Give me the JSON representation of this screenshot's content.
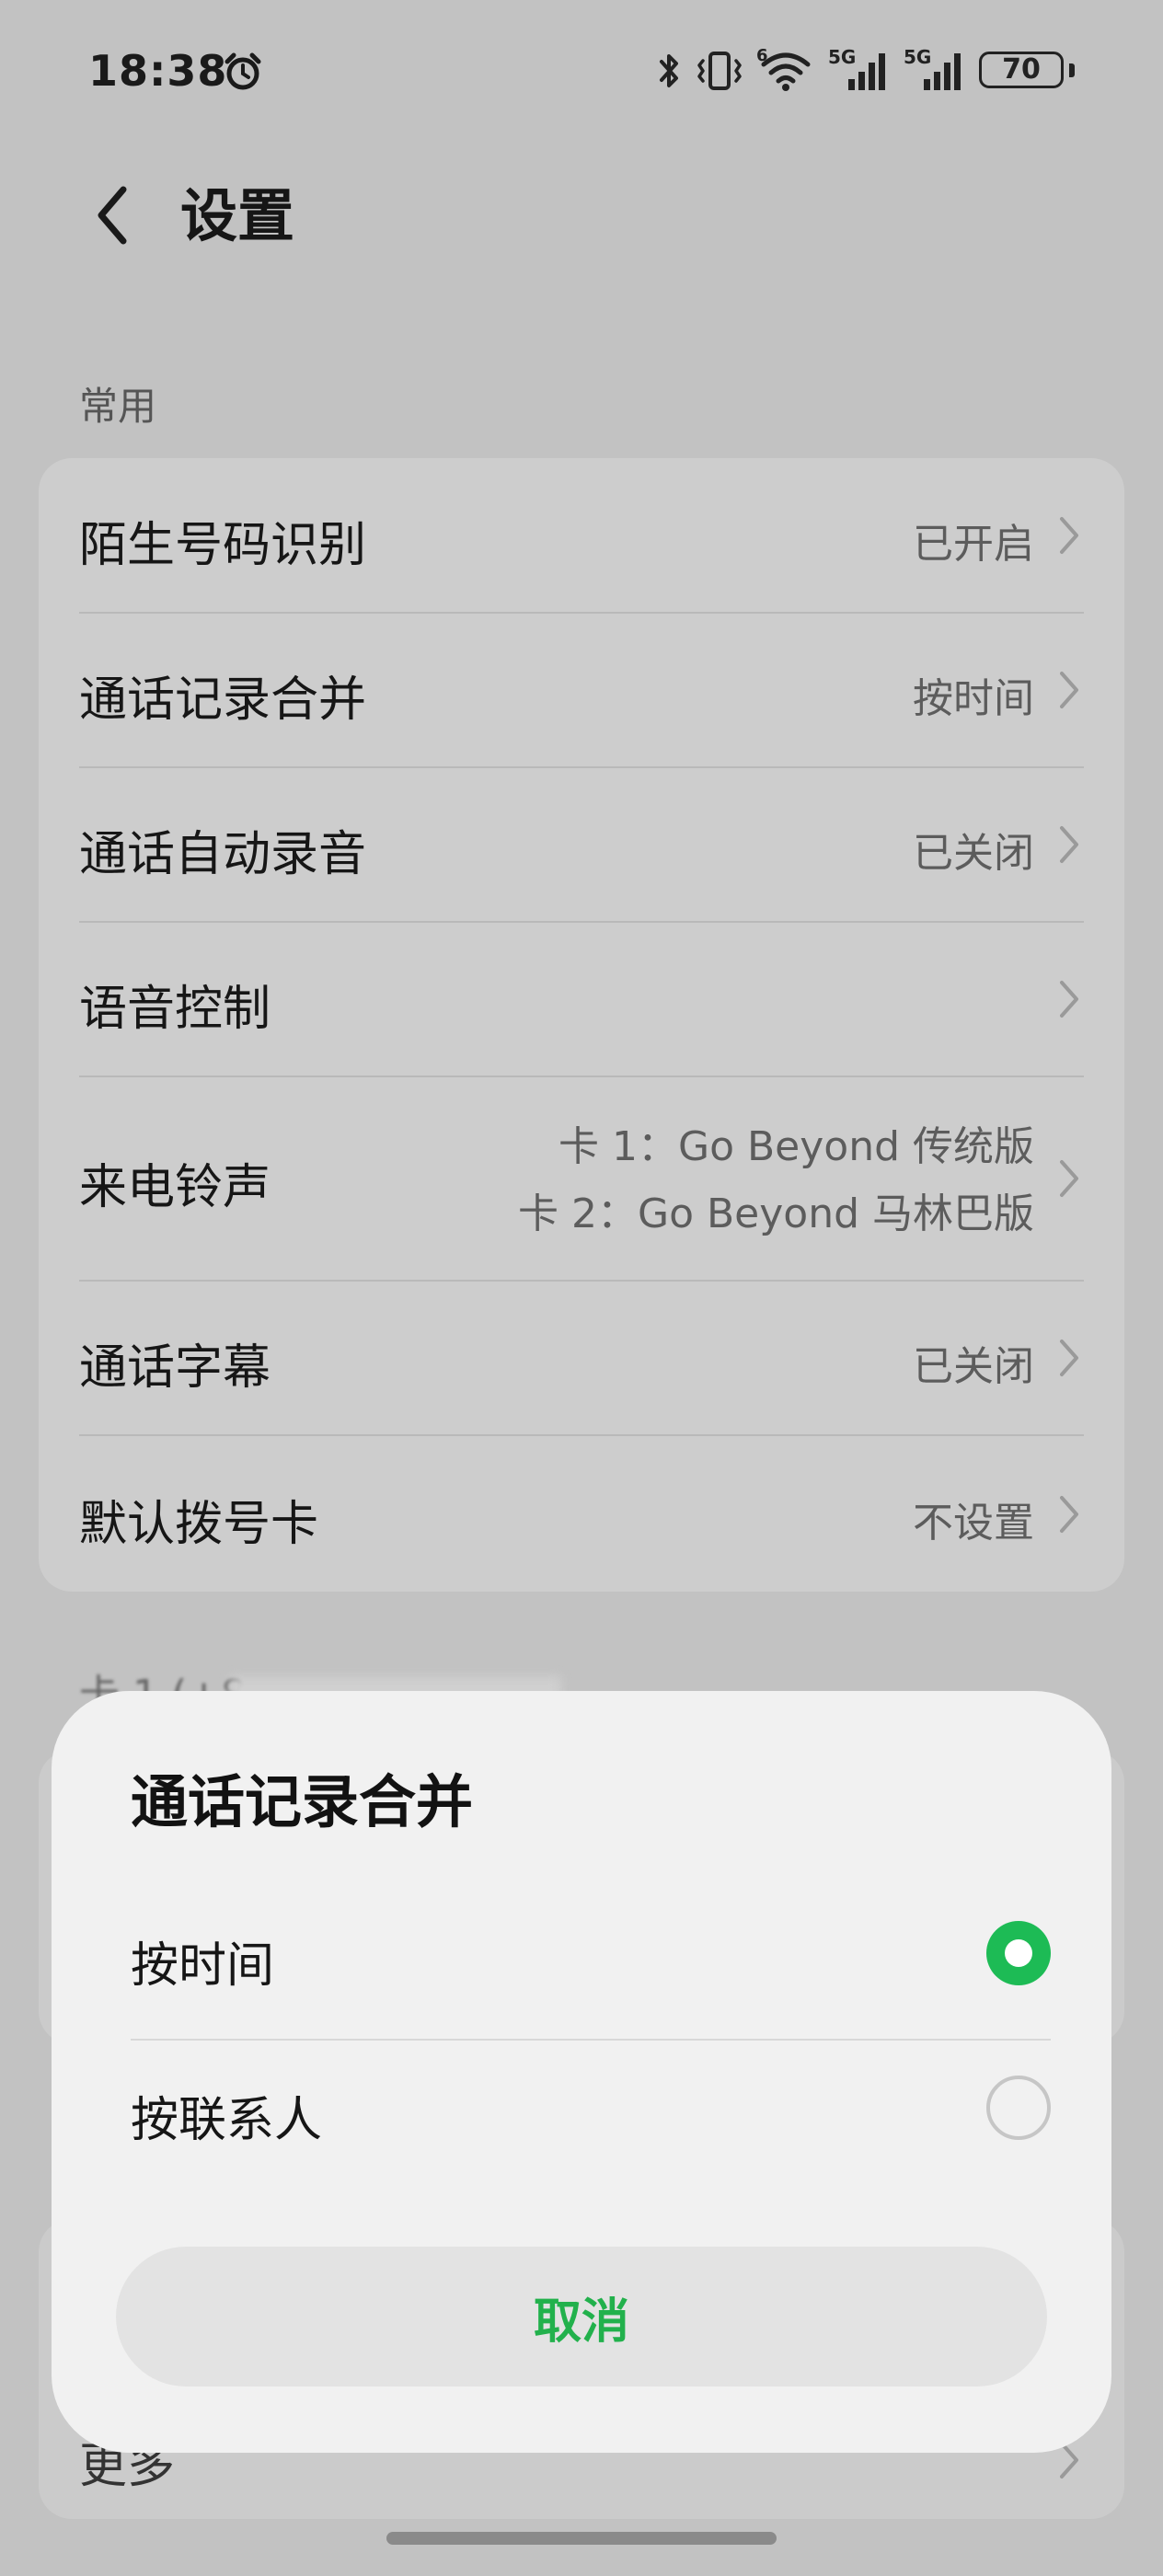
{
  "status_bar": {
    "time": "18:38",
    "battery": "70",
    "network_labels": [
      "5G",
      "5G"
    ],
    "wifi_badge": "6"
  },
  "header": {
    "title": "设置"
  },
  "sections": {
    "common_label": "常用",
    "sim1_label": "卡 1 (+8"
  },
  "settings_rows": [
    {
      "label": "陌生号码识别",
      "value": "已开启"
    },
    {
      "label": "通话记录合并",
      "value": "按时间"
    },
    {
      "label": "通话自动录音",
      "value": "已关闭"
    },
    {
      "label": "语音控制",
      "value": ""
    },
    {
      "label": "来电铃声",
      "value_line1": "卡 1：Go Beyond 传统版",
      "value_line2": "卡 2：Go Beyond 马林巴版"
    },
    {
      "label": "通话字幕",
      "value": "已关闭"
    },
    {
      "label": "默认拨号卡",
      "value": "不设置"
    }
  ],
  "partial_row": {
    "label": "更多"
  },
  "dialog": {
    "title": "通话记录合并",
    "options": [
      {
        "label": "按时间",
        "selected": true
      },
      {
        "label": "按联系人",
        "selected": false
      }
    ],
    "cancel_label": "取消"
  },
  "colors": {
    "accent": "#1dbb55",
    "background": "#c2c2c2",
    "sheet": "#f1f1f1"
  }
}
